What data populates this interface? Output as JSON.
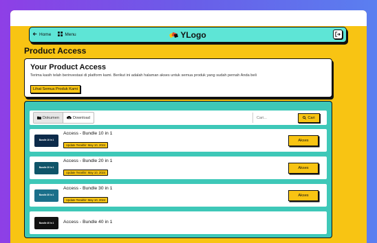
{
  "nav": {
    "home_label": "Home",
    "menu_label": "Menu",
    "logo_text": "YLogo"
  },
  "page": {
    "title": "Product Access"
  },
  "intro": {
    "title": "Your Product Access",
    "description": "Terima kasih telah berinvestasi di platform kami. Berikut ini adalah halaman akses untuk semua produk yang sudah pernah Anda beli",
    "all_products_label": "Lihat Semua Produk Kami"
  },
  "toolbar": {
    "tab_documents": "Dokumen",
    "tab_download": "Download",
    "search_placeholder": "Cari...",
    "search_button": "Cari"
  },
  "products": [
    {
      "title": "Access - Bundle 10 in 1",
      "updated": "Update Terakhir: May 10, 2024",
      "thumb": "Bundle 10 In 1",
      "button": "Akses"
    },
    {
      "title": "Access - Bundle 20 in 1",
      "updated": "Update Terakhir: May 10, 2024",
      "thumb": "Bundle 20 In 1",
      "button": "Akses"
    },
    {
      "title": "Access - Bundle 30 in 1",
      "updated": "Update Terakhir: May 10, 2024",
      "thumb": "Bundle 30 In 1",
      "button": "Akses"
    },
    {
      "title": "Access - Bundle 40 in 1",
      "updated": "",
      "thumb": "Bundle 40 In 1",
      "button": ""
    }
  ],
  "colors": {
    "accent": "#f8c413",
    "teal": "#3ec8b8",
    "nav": "#5ee5d6"
  }
}
